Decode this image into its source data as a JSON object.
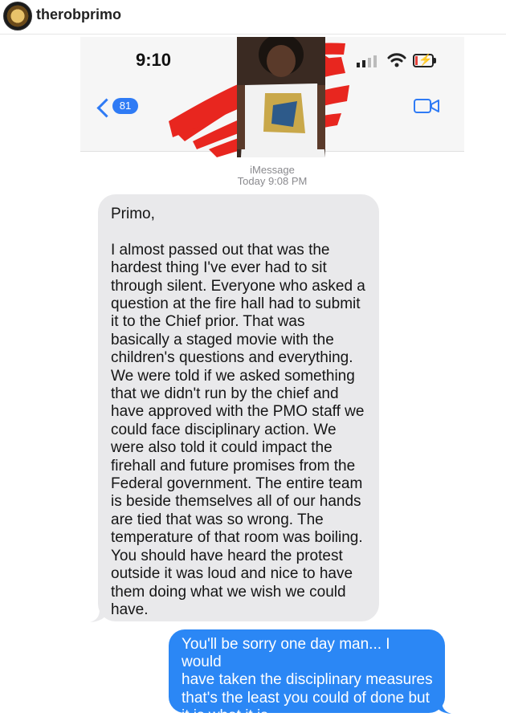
{
  "instagram": {
    "username": "therobprimo"
  },
  "status_bar": {
    "time": "9:10"
  },
  "nav": {
    "back_count": "81"
  },
  "conversation": {
    "service_label": "iMessage",
    "timestamp": "Today 9:08 PM"
  },
  "messages": {
    "received": {
      "greeting": "Primo,",
      "lines": [
        "I almost passed out that was the",
        "hardest thing I've ever had to sit",
        "through silent. Everyone who asked a",
        "question at the fire hall had to submit",
        "it to the Chief prior. That was",
        "basically a staged movie with the",
        "children's questions and everything.",
        "We were told if we asked something",
        "that we didn't run by the chief and",
        "have approved with the PMO staff we",
        "could face disciplinary action. We",
        "were also told it could impact the",
        "firehall and future promises from the",
        "Federal government. The entire team",
        "is beside themselves all of our hands",
        "are tied that was so wrong. The",
        "temperature of that room was boiling.",
        "You should have heard the protest",
        "outside it was loud and nice to have",
        "them doing what we wish we could",
        "have."
      ]
    },
    "sent": {
      "lines": [
        "You'll be sorry one day man... I would",
        "have taken the disciplinary measures",
        "that's the least you could of done but",
        "it is what it is."
      ]
    }
  },
  "colors": {
    "imessage_blue": "#2b87f5",
    "received_gray": "#e9e9eb",
    "ios_blue": "#2f7bf5",
    "scribble_red": "#e8261f"
  },
  "icons": {
    "back": "chevron-left-icon",
    "video": "video-camera-icon",
    "wifi": "wifi-icon",
    "signal": "cellular-signal-icon",
    "battery": "battery-charging-icon"
  }
}
